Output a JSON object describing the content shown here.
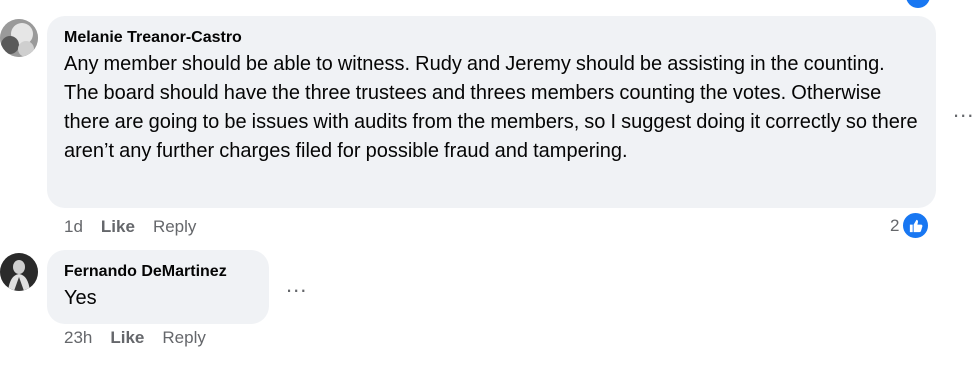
{
  "comments": [
    {
      "author": "Melanie Treanor-Castro",
      "text": "Any member should be able to witness. Rudy and Jeremy should be assisting in the counting. The board should have the three trustees and threes members counting the votes. Otherwise there are going to be issues with audits from the members, so I suggest doing it correctly so there aren’t any further charges filed for possible fraud and tampering.",
      "time": "1d",
      "like_label": "Like",
      "reply_label": "Reply",
      "reaction_count": "2",
      "reaction_icon": "thumbs-up-icon",
      "more_label": "..."
    },
    {
      "author": "Fernando DeMartinez",
      "text": "Yes",
      "time": "23h",
      "like_label": "Like",
      "reply_label": "Reply",
      "more_label": "..."
    }
  ],
  "colors": {
    "bubble": "#f0f2f5",
    "meta_text": "#65676b",
    "like_blue": "#1877f2"
  }
}
